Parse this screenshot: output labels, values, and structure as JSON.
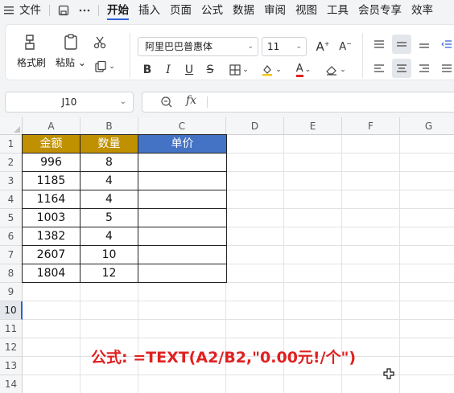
{
  "menubar": {
    "file_label": "文件",
    "tabs": [
      "开始",
      "插入",
      "页面",
      "公式",
      "数据",
      "审阅",
      "视图",
      "工具",
      "会员专享",
      "效率"
    ],
    "active_tab": "开始"
  },
  "ribbon": {
    "format_painter": "格式刷",
    "paste": "粘贴",
    "font_name": "阿里巴巴普惠体",
    "font_size": "11"
  },
  "formula_bar": {
    "name_box": "J10",
    "fx": "fx",
    "formula": ""
  },
  "sheet": {
    "columns": [
      "A",
      "B",
      "C",
      "D",
      "E",
      "F",
      "G"
    ],
    "rows": [
      "1",
      "2",
      "3",
      "4",
      "5",
      "6",
      "7",
      "8",
      "9",
      "10",
      "11",
      "12",
      "13",
      "14"
    ],
    "active_row": "10",
    "headers": {
      "a": "金额",
      "b": "数量",
      "c": "单价"
    },
    "data": [
      {
        "a": "996",
        "b": "8",
        "c": ""
      },
      {
        "a": "1185",
        "b": "4",
        "c": ""
      },
      {
        "a": "1164",
        "b": "4",
        "c": ""
      },
      {
        "a": "1003",
        "b": "5",
        "c": ""
      },
      {
        "a": "1382",
        "b": "4",
        "c": ""
      },
      {
        "a": "2607",
        "b": "10",
        "c": ""
      },
      {
        "a": "1804",
        "b": "12",
        "c": ""
      }
    ],
    "note": "公式: =TEXT(A2/B2,\"0.00元!/个\")"
  },
  "colors": {
    "header_gold": "#bf9000",
    "header_blue": "#4472c4",
    "note_red": "#e02020",
    "accent": "#2b5fd9"
  }
}
